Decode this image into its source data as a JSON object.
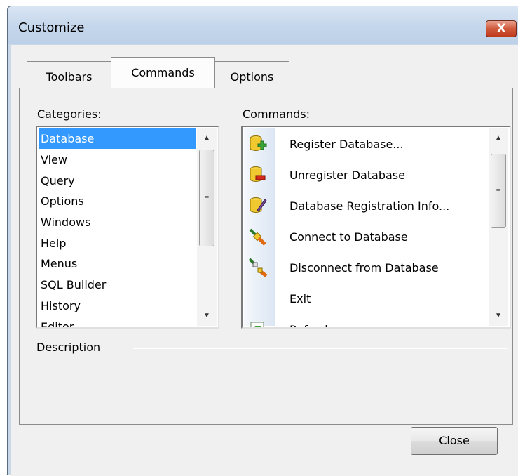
{
  "window": {
    "title": "Customize",
    "close_glyph": "X"
  },
  "tabs": [
    {
      "label": "Toolbars",
      "active": false
    },
    {
      "label": "Commands",
      "active": true
    },
    {
      "label": "Options",
      "active": false
    }
  ],
  "categories": {
    "label": "Categories:",
    "items": [
      "Database",
      "View",
      "Query",
      "Options",
      "Windows",
      "Help",
      "Menus",
      "SQL Builder",
      "History",
      "Editor"
    ],
    "selected": "Database"
  },
  "commands": {
    "label": "Commands:",
    "items": [
      {
        "label": "Register Database...",
        "icon": "database-add-icon"
      },
      {
        "label": "Unregister Database",
        "icon": "database-remove-icon"
      },
      {
        "label": "Database Registration Info...",
        "icon": "database-edit-icon"
      },
      {
        "label": "Connect to Database",
        "icon": "plug-connect-icon"
      },
      {
        "label": "Disconnect from Database",
        "icon": "plug-disconnect-icon"
      },
      {
        "label": "Exit",
        "icon": ""
      },
      {
        "label": "Refresh",
        "icon": "refresh-icon"
      }
    ]
  },
  "description": {
    "label": "Description"
  },
  "footer": {
    "close_label": "Close"
  },
  "colors": {
    "selection": "#3399ff",
    "titlebar": "#c9d8e9",
    "close_red": "#c0391b"
  }
}
